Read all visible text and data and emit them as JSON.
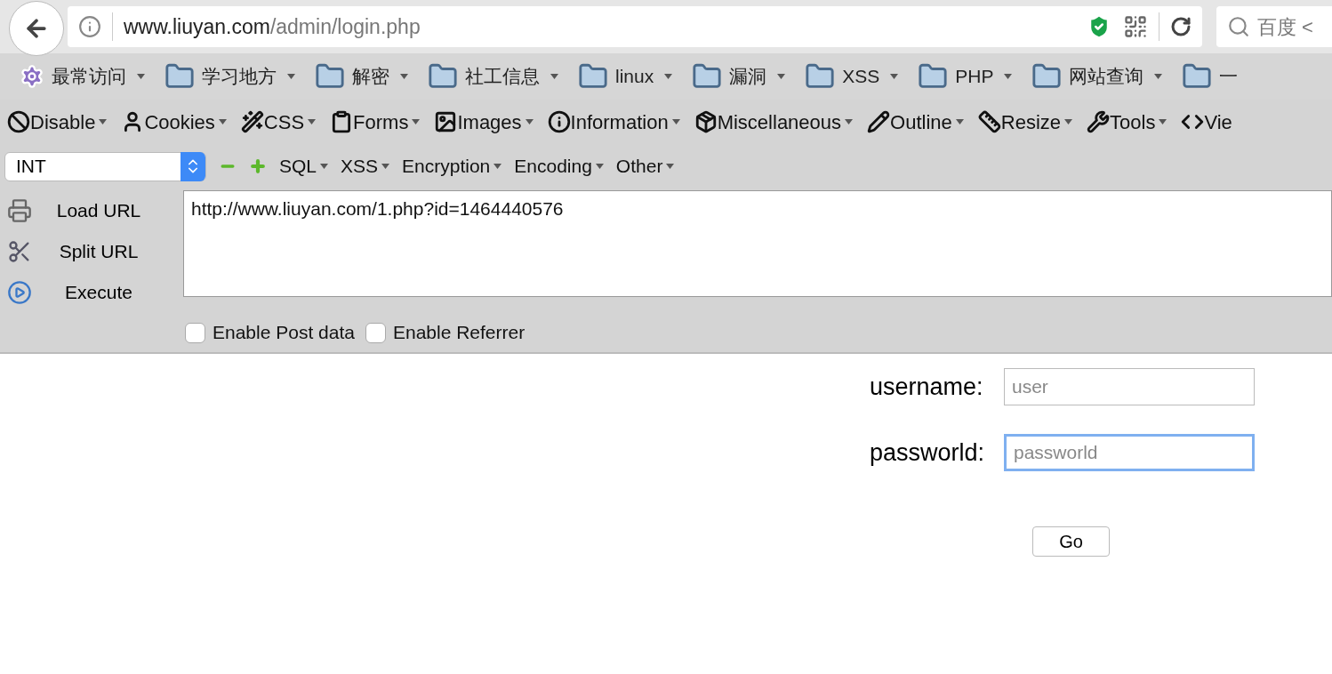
{
  "address_bar": {
    "host": "www.liuyan.com",
    "path": "/admin/login.php"
  },
  "search_box": {
    "placeholder": "百度 <"
  },
  "bookmarks": [
    {
      "label": "最常访问",
      "kind": "smart",
      "menu": true
    },
    {
      "label": "学习地方",
      "kind": "folder",
      "menu": true
    },
    {
      "label": "解密",
      "kind": "folder",
      "menu": true
    },
    {
      "label": "社工信息",
      "kind": "folder",
      "menu": true
    },
    {
      "label": "linux",
      "kind": "folder",
      "menu": true
    },
    {
      "label": "漏洞",
      "kind": "folder",
      "menu": true
    },
    {
      "label": "XSS",
      "kind": "folder",
      "menu": true
    },
    {
      "label": "PHP",
      "kind": "folder",
      "menu": true
    },
    {
      "label": "网站查询",
      "kind": "folder",
      "menu": true
    },
    {
      "label": "一",
      "kind": "folder",
      "menu": false
    }
  ],
  "toolbar": [
    {
      "label": "Disable",
      "kind": "ban",
      "menu": true
    },
    {
      "label": "Cookies",
      "kind": "user",
      "menu": true
    },
    {
      "label": "CSS",
      "kind": "wand",
      "menu": true
    },
    {
      "label": "Forms",
      "kind": "clipboard",
      "menu": true
    },
    {
      "label": "Images",
      "kind": "image",
      "menu": true
    },
    {
      "label": "Information",
      "kind": "info",
      "menu": true
    },
    {
      "label": "Miscellaneous",
      "kind": "package",
      "menu": true
    },
    {
      "label": "Outline",
      "kind": "pencil",
      "menu": true
    },
    {
      "label": "Resize",
      "kind": "ruler",
      "menu": true
    },
    {
      "label": "Tools",
      "kind": "wrench",
      "menu": true
    },
    {
      "label": "Vie",
      "kind": "code",
      "menu": false
    }
  ],
  "hackbar": {
    "encoding_select": {
      "value": "INT"
    },
    "menus": [
      "SQL",
      "XSS",
      "Encryption",
      "Encoding",
      "Other"
    ],
    "actions": [
      {
        "label": "Load URL",
        "kind": "load"
      },
      {
        "label": "Split URL",
        "kind": "split"
      },
      {
        "label": "Execute",
        "kind": "execute"
      }
    ],
    "url_text": "http://www.liuyan.com/1.php?id=1464440576",
    "options": [
      {
        "label": "Enable Post data",
        "checked": false
      },
      {
        "label": "Enable Referrer",
        "checked": false
      }
    ]
  },
  "login": {
    "fields": [
      {
        "label": "username:",
        "placeholder": "user",
        "focused": false
      },
      {
        "label": "passworld:",
        "placeholder": "passworld",
        "focused": true
      }
    ],
    "submit": "Go"
  }
}
